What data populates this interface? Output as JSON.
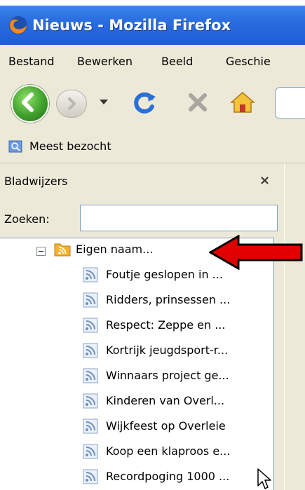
{
  "window": {
    "title": "Nieuws - Mozilla Firefox"
  },
  "menubar": {
    "items": [
      {
        "label": "Bestand"
      },
      {
        "label": "Bewerken"
      },
      {
        "label": "Beeld"
      },
      {
        "label": "Geschie"
      }
    ]
  },
  "navbar": {
    "buttons": [
      "back-icon",
      "forward-icon",
      "dropdown-icon",
      "reload-icon",
      "stop-icon",
      "home-icon"
    ]
  },
  "bookmarks_toolbar": {
    "items": [
      {
        "label": "Meest bezocht",
        "icon": "bookmark-folder-icon"
      }
    ]
  },
  "sidebar": {
    "title": "Bladwijzers",
    "close_glyph": "×",
    "search": {
      "label": "Zoeken:",
      "value": "",
      "placeholder": ""
    },
    "tree": {
      "folder": {
        "label": "Eigen naam...",
        "expanded": true,
        "icon": "rss-folder-icon"
      },
      "items": [
        {
          "label": "Foutje geslopen in ..."
        },
        {
          "label": "Ridders, prinsessen ..."
        },
        {
          "label": "Respect: Zeppe en ..."
        },
        {
          "label": "Kortrijk jeugdsport-r..."
        },
        {
          "label": "Winnaars project ge..."
        },
        {
          "label": "Kinderen van Overl..."
        },
        {
          "label": "Wijkfeest op Overleie"
        },
        {
          "label": "Koop een klaproos e..."
        },
        {
          "label": "Recordpoging 1000 ..."
        }
      ]
    }
  },
  "colors": {
    "titlebar": "#2b6fe0",
    "chrome": "#ece9d8",
    "arrow": "#e00000"
  }
}
